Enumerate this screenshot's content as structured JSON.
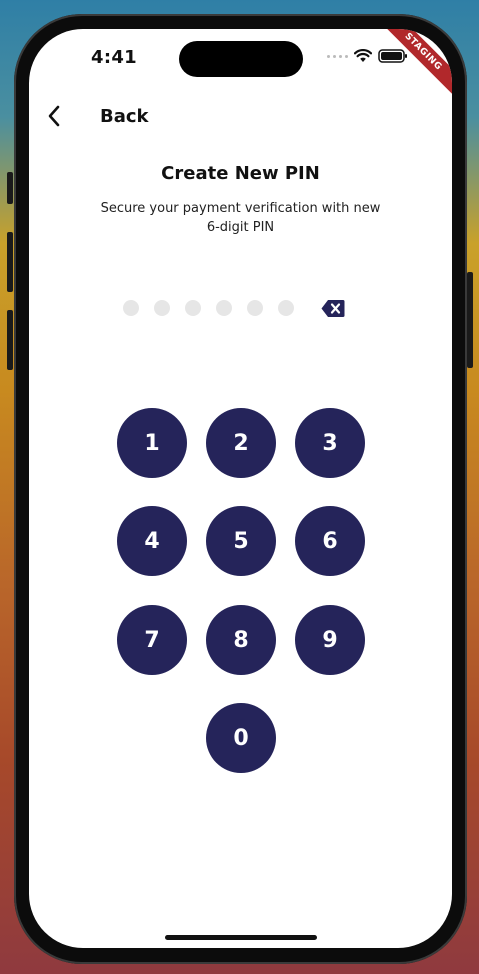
{
  "status_bar": {
    "time": "4:41",
    "badge": "STAGING",
    "icons": [
      "signal-dots-icon",
      "wifi-icon",
      "battery-icon"
    ]
  },
  "nav": {
    "back_label": "Back",
    "back_icon": "chevron-left-icon"
  },
  "header": {
    "title": "Create New PIN",
    "subtitle": "Secure your payment verification with new 6-digit PIN"
  },
  "pin": {
    "length": 6,
    "filled": 0,
    "backspace_icon": "backspace-icon"
  },
  "keypad": {
    "keys": [
      "1",
      "2",
      "3",
      "4",
      "5",
      "6",
      "7",
      "8",
      "9",
      "0"
    ]
  },
  "colors": {
    "key_background": "#25245a",
    "key_text": "#ffffff",
    "empty_dot": "#e6e6e6",
    "staging_badge": "#b1282b"
  }
}
